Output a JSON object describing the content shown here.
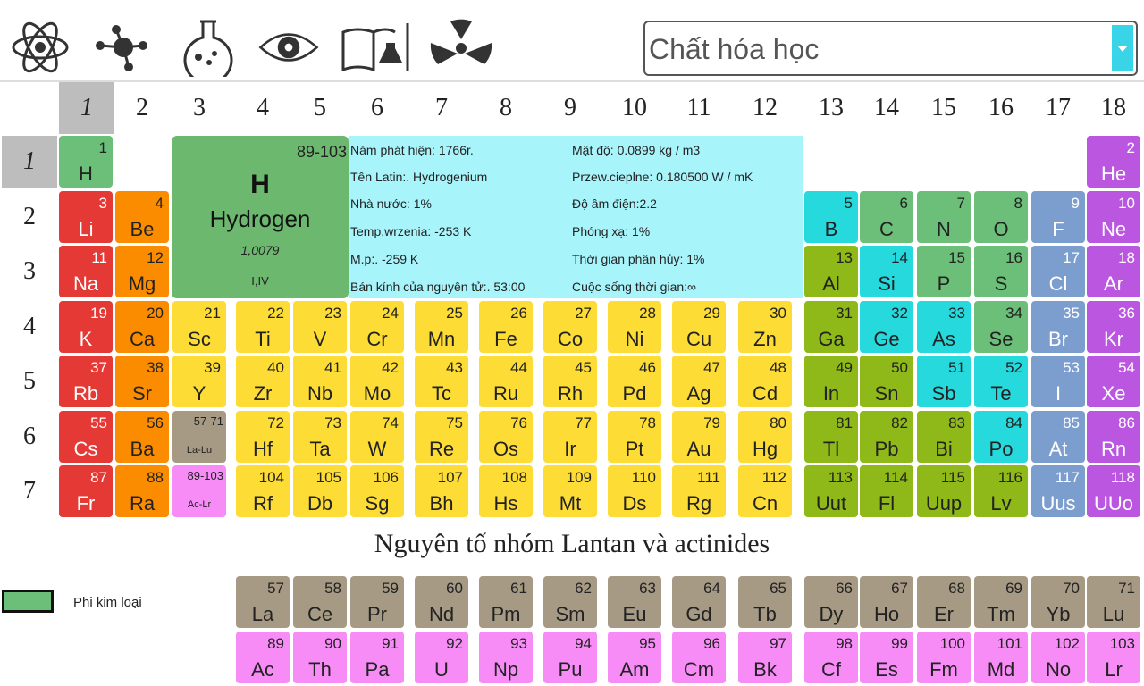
{
  "toolbar": {
    "icons": [
      "atom-icon",
      "molecule-icon",
      "flask-icon",
      "eye-icon",
      "book-flask-icon",
      "radiation-icon"
    ],
    "category_select": {
      "value": "Chất hóa học"
    }
  },
  "group_headers": [
    "1",
    "2",
    "3",
    "4",
    "5",
    "6",
    "7",
    "8",
    "9",
    "10",
    "11",
    "12",
    "13",
    "14",
    "15",
    "16",
    "17",
    "18"
  ],
  "period_headers": [
    "1",
    "2",
    "3",
    "4",
    "5",
    "6",
    "7"
  ],
  "selected_element": {
    "range": "89-103",
    "symbol": "H",
    "name": "Hydrogen",
    "mass": "1,0079",
    "valence": "I,IV"
  },
  "info": {
    "left": [
      "Năm phát hiện: 1766r.",
      "Tên Latin:. Hydrogenium",
      "Nhà nước: 1%",
      "Temp.wrzenia: -253 K",
      "M.p:. -259 K",
      "Bán kính của nguyên tử:. 53:00"
    ],
    "right": [
      "Mật độ: 0.0899 kg / m3",
      "Przew.cieplne: 0.180500 W / mK",
      "Độ âm điện:2.2",
      "Phóng xạ: 1%",
      "Thời gian phân hủy: 1%",
      "Cuộc sống thời gian:∞"
    ]
  },
  "lan_title": "Nguyên tố nhóm Lantan và actinides",
  "legend": {
    "label": "Phi kim loại",
    "color": "#6cbf78"
  },
  "colors": {
    "alk": "#e53935",
    "alke": "#fb8c00",
    "trans": "#fddc35",
    "post": "#8fb819",
    "metal": "#26d9dd",
    "non": "#6cbf78",
    "hal": "#7c9ecf",
    "nob": "#ba56e0",
    "lan": "#a69a85",
    "act": "#f78cf7"
  },
  "elements": [
    {
      "n": "1",
      "s": "H",
      "g": 1,
      "p": 1,
      "c": "c-hdr"
    },
    {
      "n": "2",
      "s": "He",
      "g": 18,
      "p": 1,
      "c": "c-nob"
    },
    {
      "n": "3",
      "s": "Li",
      "g": 1,
      "p": 2,
      "c": "c-alk"
    },
    {
      "n": "4",
      "s": "Be",
      "g": 2,
      "p": 2,
      "c": "c-alke"
    },
    {
      "n": "5",
      "s": "B",
      "g": 13,
      "p": 2,
      "c": "c-metal"
    },
    {
      "n": "6",
      "s": "C",
      "g": 14,
      "p": 2,
      "c": "c-non"
    },
    {
      "n": "7",
      "s": "N",
      "g": 15,
      "p": 2,
      "c": "c-non"
    },
    {
      "n": "8",
      "s": "O",
      "g": 16,
      "p": 2,
      "c": "c-non"
    },
    {
      "n": "9",
      "s": "F",
      "g": 17,
      "p": 2,
      "c": "c-hal"
    },
    {
      "n": "10",
      "s": "Ne",
      "g": 18,
      "p": 2,
      "c": "c-nob"
    },
    {
      "n": "11",
      "s": "Na",
      "g": 1,
      "p": 3,
      "c": "c-alk"
    },
    {
      "n": "12",
      "s": "Mg",
      "g": 2,
      "p": 3,
      "c": "c-alke"
    },
    {
      "n": "13",
      "s": "Al",
      "g": 13,
      "p": 3,
      "c": "c-post"
    },
    {
      "n": "14",
      "s": "Si",
      "g": 14,
      "p": 3,
      "c": "c-metal"
    },
    {
      "n": "15",
      "s": "P",
      "g": 15,
      "p": 3,
      "c": "c-non"
    },
    {
      "n": "16",
      "s": "S",
      "g": 16,
      "p": 3,
      "c": "c-non"
    },
    {
      "n": "17",
      "s": "Cl",
      "g": 17,
      "p": 3,
      "c": "c-hal"
    },
    {
      "n": "18",
      "s": "Ar",
      "g": 18,
      "p": 3,
      "c": "c-nob"
    },
    {
      "n": "19",
      "s": "K",
      "g": 1,
      "p": 4,
      "c": "c-alk"
    },
    {
      "n": "20",
      "s": "Ca",
      "g": 2,
      "p": 4,
      "c": "c-alke"
    },
    {
      "n": "21",
      "s": "Sc",
      "g": 3,
      "p": 4,
      "c": "c-trans"
    },
    {
      "n": "22",
      "s": "Ti",
      "g": 4,
      "p": 4,
      "c": "c-trans"
    },
    {
      "n": "23",
      "s": "V",
      "g": 5,
      "p": 4,
      "c": "c-trans"
    },
    {
      "n": "24",
      "s": "Cr",
      "g": 6,
      "p": 4,
      "c": "c-trans"
    },
    {
      "n": "25",
      "s": "Mn",
      "g": 7,
      "p": 4,
      "c": "c-trans"
    },
    {
      "n": "26",
      "s": "Fe",
      "g": 8,
      "p": 4,
      "c": "c-trans"
    },
    {
      "n": "27",
      "s": "Co",
      "g": 9,
      "p": 4,
      "c": "c-trans"
    },
    {
      "n": "28",
      "s": "Ni",
      "g": 10,
      "p": 4,
      "c": "c-trans"
    },
    {
      "n": "29",
      "s": "Cu",
      "g": 11,
      "p": 4,
      "c": "c-trans"
    },
    {
      "n": "30",
      "s": "Zn",
      "g": 12,
      "p": 4,
      "c": "c-trans"
    },
    {
      "n": "31",
      "s": "Ga",
      "g": 13,
      "p": 4,
      "c": "c-post"
    },
    {
      "n": "32",
      "s": "Ge",
      "g": 14,
      "p": 4,
      "c": "c-metal"
    },
    {
      "n": "33",
      "s": "As",
      "g": 15,
      "p": 4,
      "c": "c-metal"
    },
    {
      "n": "34",
      "s": "Se",
      "g": 16,
      "p": 4,
      "c": "c-non"
    },
    {
      "n": "35",
      "s": "Br",
      "g": 17,
      "p": 4,
      "c": "c-hal"
    },
    {
      "n": "36",
      "s": "Kr",
      "g": 18,
      "p": 4,
      "c": "c-nob"
    },
    {
      "n": "37",
      "s": "Rb",
      "g": 1,
      "p": 5,
      "c": "c-alk"
    },
    {
      "n": "38",
      "s": "Sr",
      "g": 2,
      "p": 5,
      "c": "c-alke"
    },
    {
      "n": "39",
      "s": "Y",
      "g": 3,
      "p": 5,
      "c": "c-trans"
    },
    {
      "n": "40",
      "s": "Zr",
      "g": 4,
      "p": 5,
      "c": "c-trans"
    },
    {
      "n": "41",
      "s": "Nb",
      "g": 5,
      "p": 5,
      "c": "c-trans"
    },
    {
      "n": "42",
      "s": "Mo",
      "g": 6,
      "p": 5,
      "c": "c-trans"
    },
    {
      "n": "43",
      "s": "Tc",
      "g": 7,
      "p": 5,
      "c": "c-trans"
    },
    {
      "n": "44",
      "s": "Ru",
      "g": 8,
      "p": 5,
      "c": "c-trans"
    },
    {
      "n": "45",
      "s": "Rh",
      "g": 9,
      "p": 5,
      "c": "c-trans"
    },
    {
      "n": "46",
      "s": "Pd",
      "g": 10,
      "p": 5,
      "c": "c-trans"
    },
    {
      "n": "47",
      "s": "Ag",
      "g": 11,
      "p": 5,
      "c": "c-trans"
    },
    {
      "n": "48",
      "s": "Cd",
      "g": 12,
      "p": 5,
      "c": "c-trans"
    },
    {
      "n": "49",
      "s": "In",
      "g": 13,
      "p": 5,
      "c": "c-post"
    },
    {
      "n": "50",
      "s": "Sn",
      "g": 14,
      "p": 5,
      "c": "c-post"
    },
    {
      "n": "51",
      "s": "Sb",
      "g": 15,
      "p": 5,
      "c": "c-metal"
    },
    {
      "n": "52",
      "s": "Te",
      "g": 16,
      "p": 5,
      "c": "c-metal"
    },
    {
      "n": "53",
      "s": "I",
      "g": 17,
      "p": 5,
      "c": "c-hal"
    },
    {
      "n": "54",
      "s": "Xe",
      "g": 18,
      "p": 5,
      "c": "c-nob"
    },
    {
      "n": "55",
      "s": "Cs",
      "g": 1,
      "p": 6,
      "c": "c-alk"
    },
    {
      "n": "56",
      "s": "Ba",
      "g": 2,
      "p": 6,
      "c": "c-alke"
    },
    {
      "n": "57-71",
      "s": "La-Lu",
      "g": 3,
      "p": 6,
      "c": "c-lan",
      "r": 1
    },
    {
      "n": "72",
      "s": "Hf",
      "g": 4,
      "p": 6,
      "c": "c-trans"
    },
    {
      "n": "73",
      "s": "Ta",
      "g": 5,
      "p": 6,
      "c": "c-trans"
    },
    {
      "n": "74",
      "s": "W",
      "g": 6,
      "p": 6,
      "c": "c-trans"
    },
    {
      "n": "75",
      "s": "Re",
      "g": 7,
      "p": 6,
      "c": "c-trans"
    },
    {
      "n": "76",
      "s": "Os",
      "g": 8,
      "p": 6,
      "c": "c-trans"
    },
    {
      "n": "77",
      "s": "Ir",
      "g": 9,
      "p": 6,
      "c": "c-trans"
    },
    {
      "n": "78",
      "s": "Pt",
      "g": 10,
      "p": 6,
      "c": "c-trans"
    },
    {
      "n": "79",
      "s": "Au",
      "g": 11,
      "p": 6,
      "c": "c-trans"
    },
    {
      "n": "80",
      "s": "Hg",
      "g": 12,
      "p": 6,
      "c": "c-trans"
    },
    {
      "n": "81",
      "s": "Tl",
      "g": 13,
      "p": 6,
      "c": "c-post"
    },
    {
      "n": "82",
      "s": "Pb",
      "g": 14,
      "p": 6,
      "c": "c-post"
    },
    {
      "n": "83",
      "s": "Bi",
      "g": 15,
      "p": 6,
      "c": "c-post"
    },
    {
      "n": "84",
      "s": "Po",
      "g": 16,
      "p": 6,
      "c": "c-metal"
    },
    {
      "n": "85",
      "s": "At",
      "g": 17,
      "p": 6,
      "c": "c-hal"
    },
    {
      "n": "86",
      "s": "Rn",
      "g": 18,
      "p": 6,
      "c": "c-nob"
    },
    {
      "n": "87",
      "s": "Fr",
      "g": 1,
      "p": 7,
      "c": "c-alk"
    },
    {
      "n": "88",
      "s": "Ra",
      "g": 2,
      "p": 7,
      "c": "c-alke"
    },
    {
      "n": "89-103",
      "s": "Ac-Lr",
      "g": 3,
      "p": 7,
      "c": "c-act",
      "r": 1
    },
    {
      "n": "104",
      "s": "Rf",
      "g": 4,
      "p": 7,
      "c": "c-trans"
    },
    {
      "n": "105",
      "s": "Db",
      "g": 5,
      "p": 7,
      "c": "c-trans"
    },
    {
      "n": "106",
      "s": "Sg",
      "g": 6,
      "p": 7,
      "c": "c-trans"
    },
    {
      "n": "107",
      "s": "Bh",
      "g": 7,
      "p": 7,
      "c": "c-trans"
    },
    {
      "n": "108",
      "s": "Hs",
      "g": 8,
      "p": 7,
      "c": "c-trans"
    },
    {
      "n": "109",
      "s": "Mt",
      "g": 9,
      "p": 7,
      "c": "c-trans"
    },
    {
      "n": "110",
      "s": "Ds",
      "g": 10,
      "p": 7,
      "c": "c-trans"
    },
    {
      "n": "111",
      "s": "Rg",
      "g": 11,
      "p": 7,
      "c": "c-trans"
    },
    {
      "n": "112",
      "s": "Cn",
      "g": 12,
      "p": 7,
      "c": "c-trans"
    },
    {
      "n": "113",
      "s": "Uut",
      "g": 13,
      "p": 7,
      "c": "c-post"
    },
    {
      "n": "114",
      "s": "Fl",
      "g": 14,
      "p": 7,
      "c": "c-post"
    },
    {
      "n": "115",
      "s": "Uup",
      "g": 15,
      "p": 7,
      "c": "c-post"
    },
    {
      "n": "116",
      "s": "Lv",
      "g": 16,
      "p": 7,
      "c": "c-post"
    },
    {
      "n": "117",
      "s": "Uus",
      "g": 17,
      "p": 7,
      "c": "c-hal"
    },
    {
      "n": "118",
      "s": "UUo",
      "g": 18,
      "p": 7,
      "c": "c-nob"
    }
  ],
  "lanthanides": [
    {
      "n": "57",
      "s": "La"
    },
    {
      "n": "58",
      "s": "Ce"
    },
    {
      "n": "59",
      "s": "Pr"
    },
    {
      "n": "60",
      "s": "Nd"
    },
    {
      "n": "61",
      "s": "Pm"
    },
    {
      "n": "62",
      "s": "Sm"
    },
    {
      "n": "63",
      "s": "Eu"
    },
    {
      "n": "64",
      "s": "Gd"
    },
    {
      "n": "65",
      "s": "Tb"
    },
    {
      "n": "66",
      "s": "Dy"
    },
    {
      "n": "67",
      "s": "Ho"
    },
    {
      "n": "68",
      "s": "Er"
    },
    {
      "n": "69",
      "s": "Tm"
    },
    {
      "n": "70",
      "s": "Yb"
    },
    {
      "n": "71",
      "s": "Lu"
    }
  ],
  "actinides": [
    {
      "n": "89",
      "s": "Ac"
    },
    {
      "n": "90",
      "s": "Th"
    },
    {
      "n": "91",
      "s": "Pa"
    },
    {
      "n": "92",
      "s": "U"
    },
    {
      "n": "93",
      "s": "Np"
    },
    {
      "n": "94",
      "s": "Pu"
    },
    {
      "n": "95",
      "s": "Am"
    },
    {
      "n": "96",
      "s": "Cm"
    },
    {
      "n": "97",
      "s": "Bk"
    },
    {
      "n": "98",
      "s": "Cf"
    },
    {
      "n": "99",
      "s": "Es"
    },
    {
      "n": "100",
      "s": "Fm"
    },
    {
      "n": "101",
      "s": "Md"
    },
    {
      "n": "102",
      "s": "No"
    },
    {
      "n": "103",
      "s": "Lr"
    }
  ]
}
